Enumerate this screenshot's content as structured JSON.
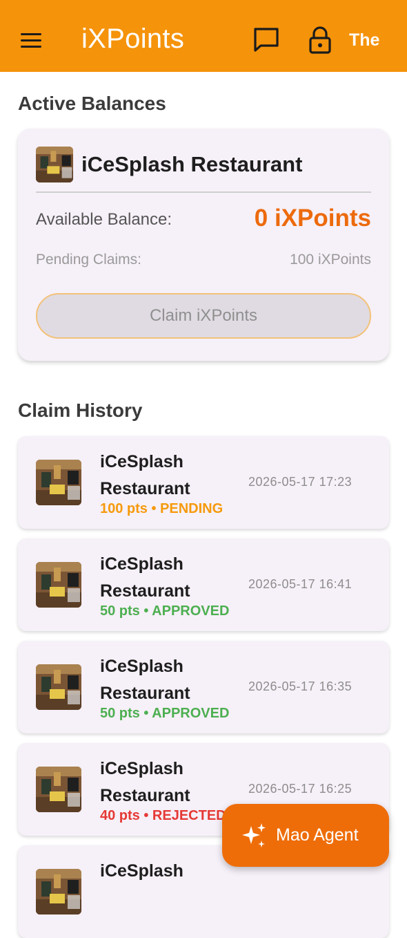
{
  "app_bar": {
    "title": "iXPoints",
    "user": "The",
    "icons": {
      "menu": "menu-icon",
      "chat": "chat-bubble-icon",
      "lock": "lock-icon"
    },
    "background": "#F5930B"
  },
  "balances": {
    "section_title": "Active Balances",
    "restaurant_name": "iCeSplash Restaurant",
    "available_label": "Available Balance:",
    "available_value": "0 iXPoints",
    "pending_label": "Pending Claims:",
    "pending_value": "100 iXPoints",
    "claim_button": "Claim iXPoints"
  },
  "history": {
    "section_title": "Claim History",
    "items": [
      {
        "name": "iCeSplash Restaurant",
        "status": "100 pts • PENDING",
        "status_color": "#F59A0C",
        "date": "2026-05-17 17:23"
      },
      {
        "name": "iCeSplash Restaurant",
        "status": "50 pts • APPROVED",
        "status_color": "#4CAF50",
        "date": "2026-05-17 16:41"
      },
      {
        "name": "iCeSplash Restaurant",
        "status": "50 pts • APPROVED",
        "status_color": "#4CAF50",
        "date": "2026-05-17 16:35"
      },
      {
        "name": "iCeSplash Restaurant",
        "status": "40 pts • REJECTED",
        "status_color": "#E53935",
        "date": "2026-05-17 16:25"
      },
      {
        "name": "iCeSplash",
        "status": "",
        "status_color": "#4CAF50",
        "date": ""
      }
    ]
  },
  "fab": {
    "label": "Mao Agent",
    "icon": "sparkle-icon",
    "color": "#EE6D09"
  },
  "colors": {
    "accent": "#EC6A0C",
    "card_bg": "#F6F0F8"
  }
}
